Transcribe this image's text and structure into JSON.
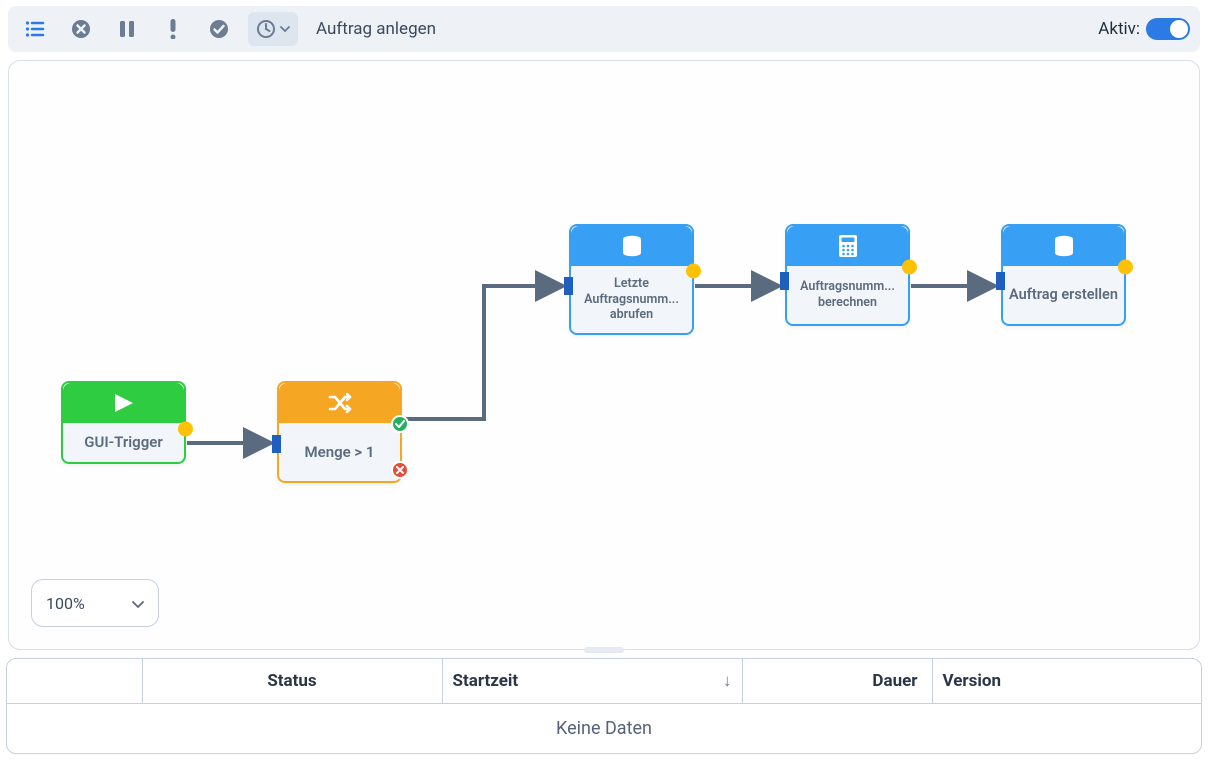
{
  "toolbar": {
    "title": "Auftrag anlegen",
    "active_label": "Aktiv:"
  },
  "nodes": {
    "trigger": {
      "label": "GUI-Trigger"
    },
    "condition": {
      "label": "Menge > 1"
    },
    "db1": {
      "label": "Letzte Auftragsnumm... abrufen"
    },
    "calc": {
      "label": "Auftragsnumm... berechnen"
    },
    "db2": {
      "label": "Auftrag erstellen"
    }
  },
  "zoom": {
    "value": "100%"
  },
  "table": {
    "columns": {
      "status": "Status",
      "startzeit": "Startzeit",
      "dauer": "Dauer",
      "version": "Version"
    },
    "empty": "Keine Daten"
  }
}
